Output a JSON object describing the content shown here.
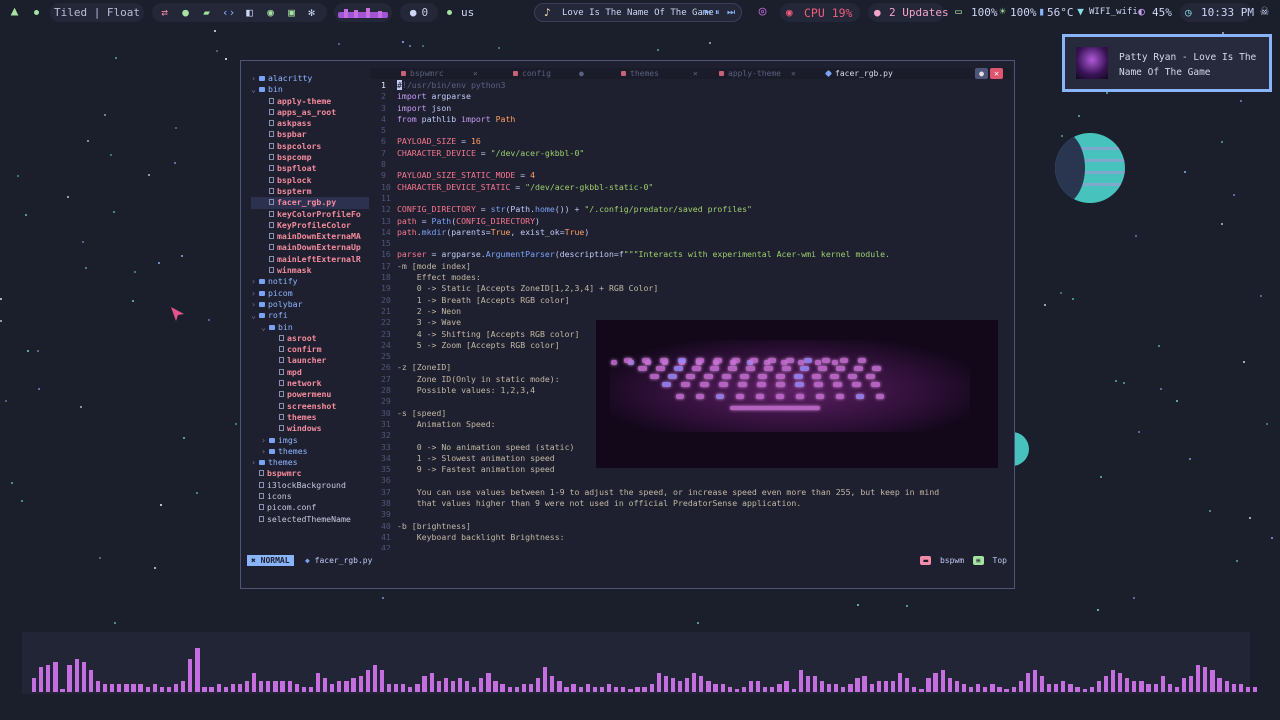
{
  "colors": {
    "background": "#1b1e2b",
    "accent_blue": "#89b4fa",
    "accent_pink": "#f38b9c",
    "accent_purple": "#c56ee0",
    "cpu_red": "#f05d7b",
    "teal": "#47c2bd"
  },
  "topbar": {
    "logo_icon": "arch-logo-icon",
    "layout_label": "Tiled | Float",
    "github_count": "0",
    "keyboard_layout": "us",
    "music_title": "Love Is The Name Of The Game",
    "cpu": "CPU 19%",
    "updates": "2 Updates",
    "battery": "100%",
    "brightness": "100%",
    "temperature": "56°C",
    "wifi": "WIFI_wifi",
    "volume": "45%",
    "clock": "10:33 PM"
  },
  "notification": {
    "text": "Patty Ryan - Love Is The Name Of The Game"
  },
  "editor": {
    "tabs": [
      {
        "label": "bspwmrc",
        "active": false
      },
      {
        "label": "config",
        "active": false
      },
      {
        "label": "themes",
        "active": false
      },
      {
        "label": "apply-theme",
        "active": false
      },
      {
        "label": "facer_rgb.py",
        "active": true
      }
    ],
    "tree": [
      {
        "label": "alacritty",
        "kind": "dir",
        "depth": 0,
        "open": false
      },
      {
        "label": "bin",
        "kind": "dir",
        "depth": 0,
        "open": true
      },
      {
        "label": "apply-theme",
        "kind": "exec",
        "depth": 1
      },
      {
        "label": "apps_as_root",
        "kind": "exec",
        "depth": 1
      },
      {
        "label": "askpass",
        "kind": "exec",
        "depth": 1
      },
      {
        "label": "bspbar",
        "kind": "exec",
        "depth": 1
      },
      {
        "label": "bspcolors",
        "kind": "exec",
        "depth": 1
      },
      {
        "label": "bspcomp",
        "kind": "exec",
        "depth": 1
      },
      {
        "label": "bspfloat",
        "kind": "exec",
        "depth": 1
      },
      {
        "label": "bsplock",
        "kind": "exec",
        "depth": 1
      },
      {
        "label": "bspterm",
        "kind": "exec",
        "depth": 1
      },
      {
        "label": "facer_rgb.py",
        "kind": "exec",
        "depth": 1,
        "selected": true
      },
      {
        "label": "keyColorProfileFo",
        "kind": "exec",
        "depth": 1
      },
      {
        "label": "KeyProfileColor",
        "kind": "exec",
        "depth": 1
      },
      {
        "label": "mainDownExternaMA",
        "kind": "exec",
        "depth": 1
      },
      {
        "label": "mainDownExternaUp",
        "kind": "exec",
        "depth": 1
      },
      {
        "label": "mainLeftExternalR",
        "kind": "exec",
        "depth": 1
      },
      {
        "label": "winmask",
        "kind": "exec",
        "depth": 1
      },
      {
        "label": "notify",
        "kind": "dir",
        "depth": 0,
        "open": false
      },
      {
        "label": "picom",
        "kind": "dir",
        "depth": 0,
        "open": false
      },
      {
        "label": "polybar",
        "kind": "dir",
        "depth": 0,
        "open": false
      },
      {
        "label": "rofi",
        "kind": "dir",
        "depth": 0,
        "open": true
      },
      {
        "label": "bin",
        "kind": "dir",
        "depth": 1,
        "open": true
      },
      {
        "label": "asroot",
        "kind": "exec",
        "depth": 2
      },
      {
        "label": "confirm",
        "kind": "exec",
        "depth": 2
      },
      {
        "label": "launcher",
        "kind": "exec",
        "depth": 2
      },
      {
        "label": "mpd",
        "kind": "exec",
        "depth": 2
      },
      {
        "label": "network",
        "kind": "exec",
        "depth": 2
      },
      {
        "label": "powermenu",
        "kind": "exec",
        "depth": 2
      },
      {
        "label": "screenshot",
        "kind": "exec",
        "depth": 2
      },
      {
        "label": "themes",
        "kind": "exec",
        "depth": 2
      },
      {
        "label": "windows",
        "kind": "exec",
        "depth": 2
      },
      {
        "label": "imgs",
        "kind": "dir",
        "depth": 1,
        "open": false
      },
      {
        "label": "themes",
        "kind": "dir",
        "depth": 1,
        "open": false
      },
      {
        "label": "themes",
        "kind": "dir",
        "depth": 0,
        "open": false
      },
      {
        "label": "bspwmrc",
        "kind": "exec",
        "depth": 0
      },
      {
        "label": "i3lockBackground",
        "kind": "plain",
        "depth": 0
      },
      {
        "label": "icons",
        "kind": "plain",
        "depth": 0
      },
      {
        "label": "picom.conf",
        "kind": "plain",
        "depth": 0
      },
      {
        "label": "selectedThemeName",
        "kind": "plain",
        "depth": 0
      }
    ],
    "code": [
      [
        [
          "com",
          "#!/usr/bin/env python3"
        ]
      ],
      [
        [
          "kw",
          "import"
        ],
        [
          "def",
          " argparse"
        ]
      ],
      [
        [
          "kw",
          "import"
        ],
        [
          "def",
          " json"
        ]
      ],
      [
        [
          "kw",
          "from"
        ],
        [
          "def",
          " pathlib "
        ],
        [
          "kw",
          "import"
        ],
        [
          "def",
          " "
        ],
        [
          "num",
          "Path"
        ]
      ],
      [],
      [
        [
          "var",
          "PAYLOAD_SIZE"
        ],
        [
          "def",
          " = "
        ],
        [
          "num",
          "16"
        ]
      ],
      [
        [
          "var",
          "CHARACTER_DEVICE"
        ],
        [
          "def",
          " = "
        ],
        [
          "str",
          "\"/dev/acer-gkbbl-0\""
        ]
      ],
      [],
      [
        [
          "var",
          "PAYLOAD_SIZE_STATIC_MODE"
        ],
        [
          "def",
          " = "
        ],
        [
          "num",
          "4"
        ]
      ],
      [
        [
          "var",
          "CHARACTER_DEVICE_STATIC"
        ],
        [
          "def",
          " = "
        ],
        [
          "str",
          "\"/dev/acer-gkbbl-static-0\""
        ]
      ],
      [],
      [
        [
          "var",
          "CONFIG_DIRECTORY"
        ],
        [
          "def",
          " = "
        ],
        [
          "fn",
          "str"
        ],
        [
          "def",
          "(Path."
        ],
        [
          "fn",
          "home"
        ],
        [
          "def",
          "()) + "
        ],
        [
          "str",
          "\"/.config/predator/saved profiles\""
        ]
      ],
      [
        [
          "var",
          "path"
        ],
        [
          "def",
          " = "
        ],
        [
          "fn",
          "Path"
        ],
        [
          "def",
          "("
        ],
        [
          "var",
          "CONFIG_DIRECTORY"
        ],
        [
          "def",
          ")"
        ]
      ],
      [
        [
          "var",
          "path"
        ],
        [
          "def",
          "."
        ],
        [
          "fn",
          "mkdir"
        ],
        [
          "def",
          "(parents="
        ],
        [
          "num",
          "True"
        ],
        [
          "def",
          ", exist_ok="
        ],
        [
          "num",
          "True"
        ],
        [
          "def",
          ")"
        ]
      ],
      [],
      [
        [
          "var",
          "parser"
        ],
        [
          "def",
          " = argparse."
        ],
        [
          "fn",
          "ArgumentParser"
        ],
        [
          "def",
          "(description=f"
        ],
        [
          "str",
          "\"\"\"Interacts with experimental Acer-wmi kernel module."
        ]
      ],
      [
        [
          "txt",
          "-m [mode index]"
        ]
      ],
      [
        [
          "txt",
          "    Effect modes:"
        ]
      ],
      [
        [
          "txt",
          "    0 -> Static [Accepts ZoneID[1,2,3,4] + RGB Color]"
        ]
      ],
      [
        [
          "txt",
          "    1 -> Breath [Accepts RGB color]"
        ]
      ],
      [
        [
          "txt",
          "    2 -> Neon"
        ]
      ],
      [
        [
          "txt",
          "    3 -> Wave"
        ]
      ],
      [
        [
          "txt",
          "    4 -> Shifting [Accepts RGB color]"
        ]
      ],
      [
        [
          "txt",
          "    5 -> Zoom [Accepts RGB color]"
        ]
      ],
      [],
      [
        [
          "txt",
          "-z [ZoneID]"
        ]
      ],
      [
        [
          "txt",
          "    Zone ID(Only in static mode):"
        ]
      ],
      [
        [
          "txt",
          "    Possible values: 1,2,3,4"
        ]
      ],
      [],
      [
        [
          "txt",
          "-s [speed]"
        ]
      ],
      [
        [
          "txt",
          "    Animation Speed:"
        ]
      ],
      [],
      [
        [
          "txt",
          "    0 -> No animation speed (static)"
        ]
      ],
      [
        [
          "txt",
          "    1 -> Slowest animation speed"
        ]
      ],
      [
        [
          "txt",
          "    9 -> Fastest animation speed"
        ]
      ],
      [],
      [
        [
          "txt",
          "    You can use values between 1-9 to adjust the speed, or increase speed even more than 255, but keep in mind"
        ]
      ],
      [
        [
          "txt",
          "    that values higher than 9 were not used in official PredatorSense application."
        ]
      ],
      [],
      [
        [
          "txt",
          "-b [brightness]"
        ]
      ],
      [
        [
          "txt",
          "    Keyboard backlight Brightness:"
        ]
      ],
      []
    ],
    "current_line": 1,
    "status": {
      "mode": "NORMAL",
      "file": "facer_rgb.py",
      "wm": "bspwm",
      "position": "Top"
    }
  },
  "visualizer": {
    "levels": [
      0.25,
      0.45,
      0.5,
      0.55,
      0.05,
      0.5,
      0.6,
      0.55,
      0.4,
      0.2,
      0.15,
      0.15,
      0.15,
      0.15,
      0.15,
      0.15,
      0.1,
      0.15,
      0.1,
      0.1,
      0.15,
      0.2,
      0.6,
      0.8,
      0.1,
      0.1,
      0.15,
      0.1,
      0.15,
      0.15,
      0.2,
      0.35,
      0.2,
      0.2,
      0.2,
      0.2,
      0.2,
      0.15,
      0.1,
      0.1,
      0.35,
      0.25,
      0.15,
      0.2,
      0.2,
      0.25,
      0.3,
      0.4,
      0.5,
      0.4,
      0.15,
      0.15,
      0.15,
      0.1,
      0.15,
      0.3,
      0.35,
      0.2,
      0.25,
      0.2,
      0.25,
      0.2,
      0.1,
      0.25,
      0.35,
      0.2,
      0.15,
      0.1,
      0.1,
      0.15,
      0.15,
      0.25,
      0.45,
      0.3,
      0.2,
      0.1,
      0.15,
      0.1,
      0.15,
      0.1,
      0.1,
      0.15,
      0.1,
      0.1,
      0.05,
      0.1,
      0.1,
      0.15,
      0.35,
      0.3,
      0.25,
      0.2,
      0.25,
      0.35,
      0.3,
      0.2,
      0.15,
      0.15,
      0.1,
      0.05,
      0.1,
      0.2,
      0.2,
      0.1,
      0.1,
      0.15,
      0.2,
      0.05,
      0.4,
      0.3,
      0.3,
      0.2,
      0.15,
      0.15,
      0.1,
      0.15,
      0.25,
      0.3,
      0.15,
      0.2,
      0.2,
      0.2,
      0.35,
      0.25,
      0.1,
      0.05,
      0.25,
      0.35,
      0.4,
      0.25,
      0.2,
      0.15,
      0.1,
      0.15,
      0.1,
      0.15,
      0.1,
      0.05,
      0.1,
      0.2,
      0.35,
      0.4,
      0.3,
      0.15,
      0.15,
      0.2,
      0.15,
      0.1,
      0.05,
      0.1,
      0.2,
      0.3,
      0.4,
      0.35,
      0.25,
      0.2,
      0.2,
      0.15,
      0.15,
      0.3,
      0.15,
      0.1,
      0.25,
      0.3,
      0.5,
      0.45,
      0.4,
      0.25,
      0.2,
      0.15,
      0.15,
      0.1,
      0.1
    ]
  }
}
